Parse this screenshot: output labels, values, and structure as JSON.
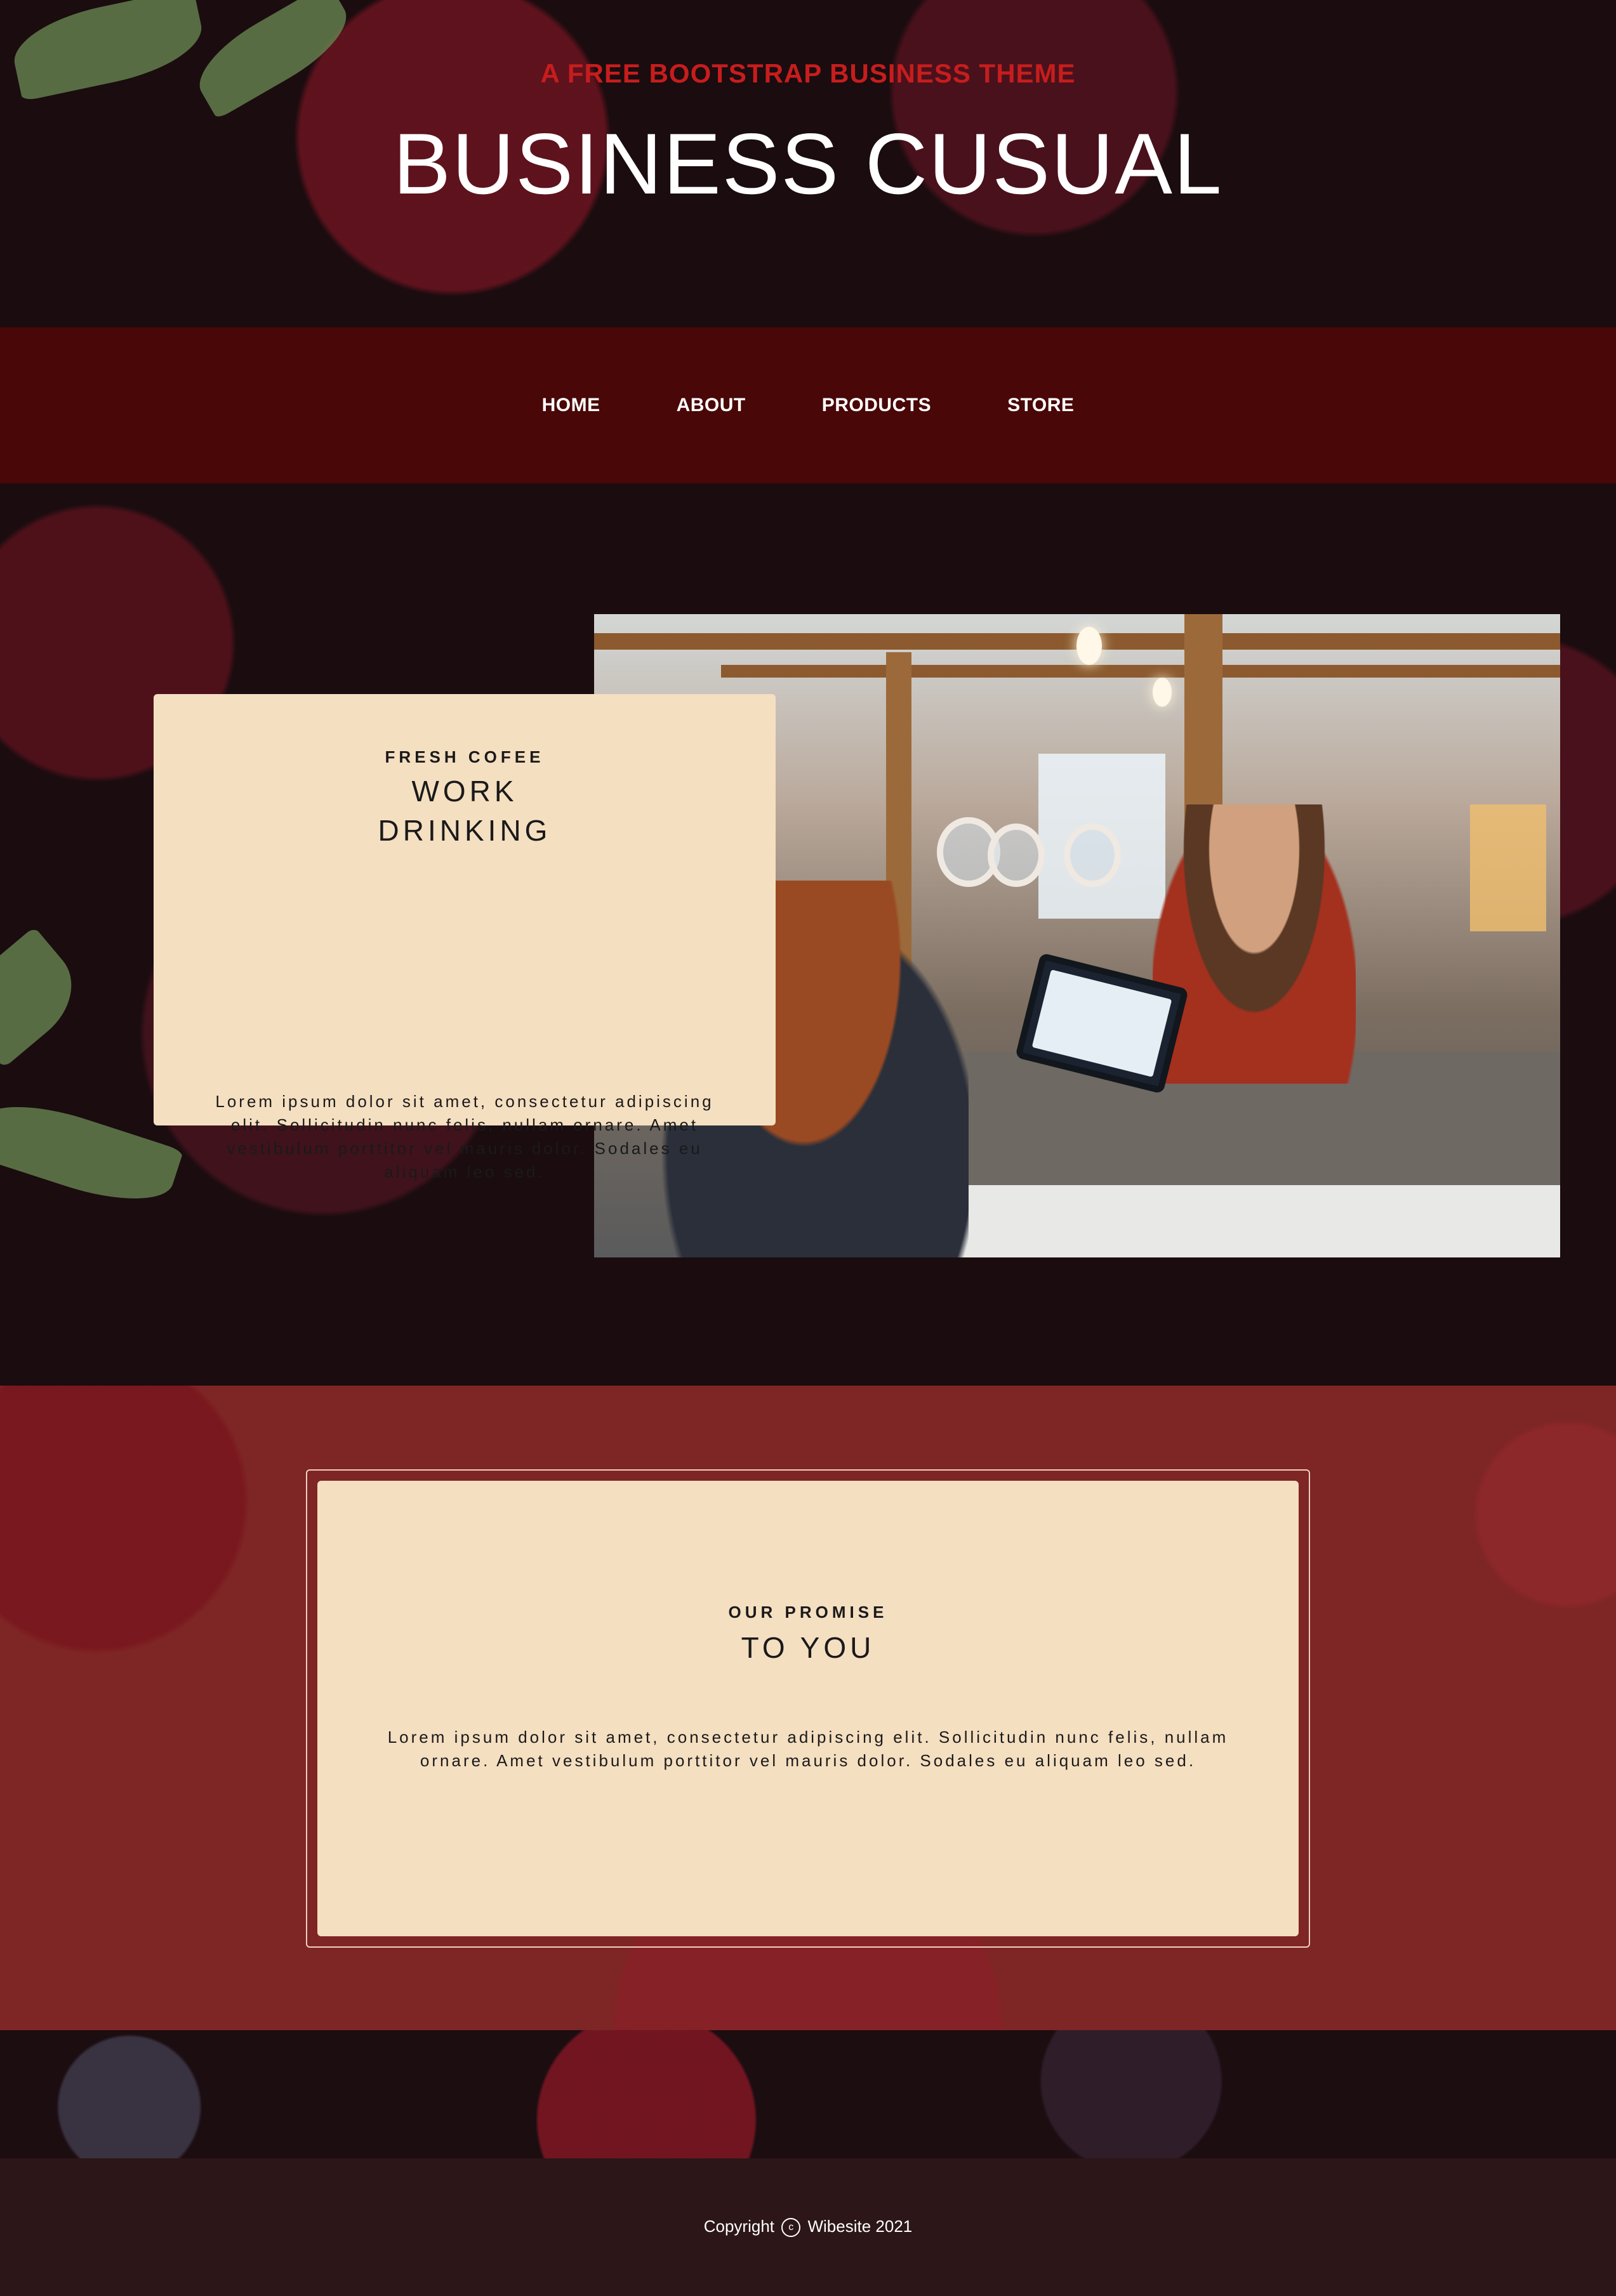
{
  "header": {
    "tagline": "A FREE BOOTSTRAP BUSINESS THEME",
    "title": "BUSINESS CUSUAL"
  },
  "nav": {
    "items": [
      {
        "label": "HOME"
      },
      {
        "label": "ABOUT"
      },
      {
        "label": "PRODUCTS"
      },
      {
        "label": "STORE"
      }
    ]
  },
  "intro": {
    "eyebrow": "FRESH COFEE",
    "heading_line1": "WORK",
    "heading_line2": "DRINKING",
    "body": "Lorem ipsum dolor sit amet, consectetur adipiscing elit. Sollicitudin nunc felis, nullam ornare. Amet vestibulum porttitor vel mauris dolor. Sodales eu aliquam leo sed."
  },
  "promise": {
    "eyebrow": "OUR PROMISE",
    "heading": "TO YOU",
    "body": "Lorem ipsum dolor sit amet, consectetur adipiscing elit. Sollicitudin nunc felis, nullam ornare. Amet vestibulum porttitor vel mauris dolor. Sodales eu aliquam leo sed."
  },
  "footer": {
    "copyright_prefix": "Copyright",
    "copyright_symbol": "c",
    "copyright_suffix": "Wibesite 2021"
  },
  "colors": {
    "tagline": "#c71d1d",
    "nav_background": "#490707",
    "card_background": "#f5dfc1",
    "promise_background": "#7e2525",
    "footer_background": "#2c1617"
  },
  "icons": {
    "copyright": "copyright-icon"
  }
}
